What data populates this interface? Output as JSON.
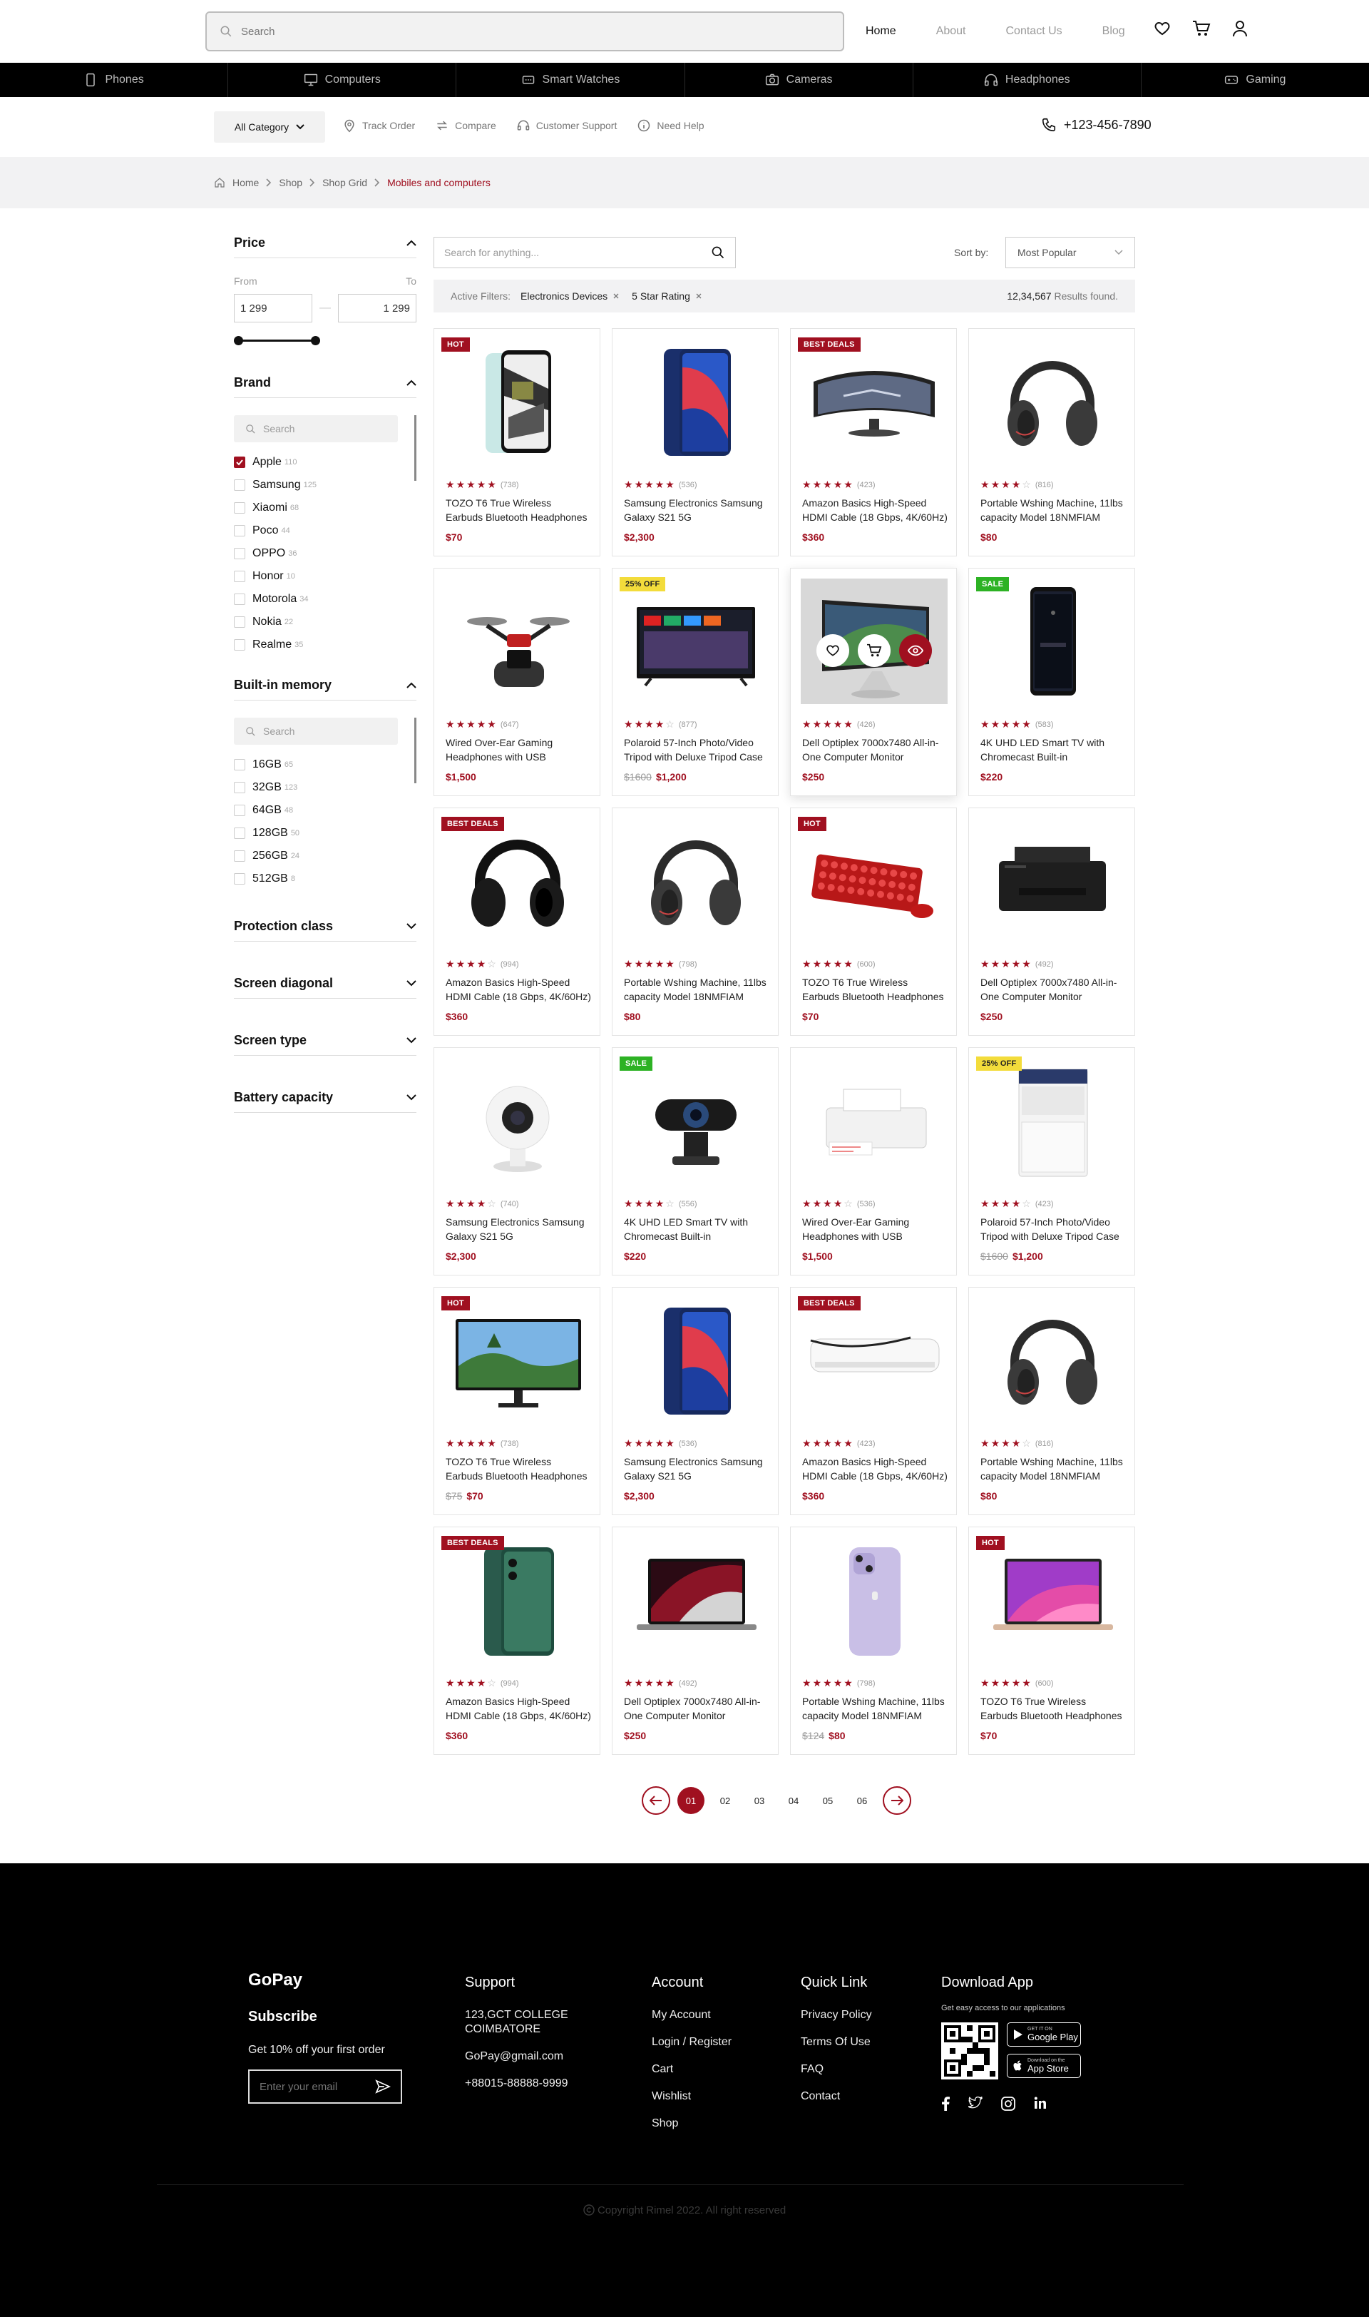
{
  "header": {
    "search_placeholder": "Search",
    "nav": [
      {
        "label": "Home",
        "active": true
      },
      {
        "label": "About",
        "active": false
      },
      {
        "label": "Contact Us",
        "active": false
      },
      {
        "label": "Blog",
        "active": false
      }
    ]
  },
  "categories": [
    {
      "label": "Phones",
      "icon": "phone-icon"
    },
    {
      "label": "Computers",
      "icon": "monitor-icon"
    },
    {
      "label": "Smart Watches",
      "icon": "watch-icon"
    },
    {
      "label": "Cameras",
      "icon": "camera-icon"
    },
    {
      "label": "Headphones",
      "icon": "headphones-icon"
    },
    {
      "label": "Gaming",
      "icon": "gamepad-icon"
    }
  ],
  "subbar": {
    "all_category": "All Category",
    "links": [
      {
        "label": "Track Order",
        "icon": "location-pin-icon"
      },
      {
        "label": "Compare",
        "icon": "compare-arrows-icon"
      },
      {
        "label": "Customer Support",
        "icon": "headset-icon"
      },
      {
        "label": "Need Help",
        "icon": "info-circle-icon"
      }
    ],
    "phone": "+123-456-7890"
  },
  "breadcrumb": [
    "Home",
    "Shop",
    "Shop Grid",
    "Mobiles and computers"
  ],
  "filters": {
    "price": {
      "title": "Price",
      "from_label": "From",
      "to_label": "To",
      "from_value": "1 299",
      "to_value": "1 299",
      "range_fraction": [
        0.0,
        0.44
      ]
    },
    "brand": {
      "title": "Brand",
      "search_placeholder": "Search",
      "items": [
        {
          "label": "Apple",
          "count": "110",
          "checked": true
        },
        {
          "label": "Samsung",
          "count": "125",
          "checked": false
        },
        {
          "label": "Xiaomi",
          "count": "68",
          "checked": false
        },
        {
          "label": "Poco",
          "count": "44",
          "checked": false
        },
        {
          "label": "OPPO",
          "count": "36",
          "checked": false
        },
        {
          "label": "Honor",
          "count": "10",
          "checked": false
        },
        {
          "label": "Motorola",
          "count": "34",
          "checked": false
        },
        {
          "label": "Nokia",
          "count": "22",
          "checked": false
        },
        {
          "label": "Realme",
          "count": "35",
          "checked": false
        }
      ]
    },
    "memory": {
      "title": "Built-in memory",
      "search_placeholder": "Search",
      "items": [
        {
          "label": "16GB",
          "count": "65",
          "checked": false
        },
        {
          "label": "32GB",
          "count": "123",
          "checked": false
        },
        {
          "label": "64GB",
          "count": "48",
          "checked": false
        },
        {
          "label": "128GB",
          "count": "50",
          "checked": false
        },
        {
          "label": "256GB",
          "count": "24",
          "checked": false
        },
        {
          "label": "512GB",
          "count": "8",
          "checked": false
        }
      ]
    },
    "collapsed": [
      "Protection class",
      "Screen diagonal",
      "Screen type",
      "Battery capacity"
    ]
  },
  "toolbar": {
    "search_placeholder": "Search for anything...",
    "sort_label": "Sort by:",
    "sort_value": "Most Popular",
    "active_filters_label": "Active Filters:",
    "active_filters": [
      "Electronics Devices",
      "5 Star Rating"
    ],
    "results_count": "12,34,567",
    "results_suffix": "Results found."
  },
  "products": [
    {
      "badge": "HOT",
      "img": "phone-white",
      "rating": 5,
      "count": "(738)",
      "title": "TOZO T6 True Wireless Earbuds Bluetooth Headphones",
      "old": "",
      "price": "$70"
    },
    {
      "badge": "",
      "img": "phone-blue",
      "rating": 5,
      "count": "(536)",
      "title": "Samsung Electronics Samsung Galaxy S21 5G",
      "old": "",
      "price": "$2,300"
    },
    {
      "badge": "BEST DEALS",
      "img": "monitor-curved",
      "rating": 5,
      "count": "(423)",
      "title": "Amazon Basics High-Speed HDMI Cable (18 Gbps, 4K/60Hz)",
      "old": "",
      "price": "$360"
    },
    {
      "badge": "",
      "img": "headphones-dark",
      "rating": 4,
      "count": "(816)",
      "title": "Portable Wshing Machine, 11lbs capacity Model 18NMFIAM",
      "old": "",
      "price": "$80"
    },
    {
      "badge": "",
      "img": "drone",
      "rating": 5,
      "count": "(647)",
      "title": "Wired Over-Ear Gaming Headphones with USB",
      "old": "",
      "price": "$1,500"
    },
    {
      "badge": "25% OFF",
      "img": "tv",
      "rating": 4,
      "count": "(877)",
      "title": "Polaroid 57-Inch Photo/Video Tripod with Deluxe Tripod Case",
      "old": "$1600",
      "price": "$1,200"
    },
    {
      "badge": "",
      "img": "monitor-imac",
      "rating": 5,
      "count": "(426)",
      "title": "Dell Optiplex 7000x7480 All-in-One Computer Monitor",
      "old": "",
      "price": "$250",
      "hover": true
    },
    {
      "badge": "SALE",
      "img": "phone-black",
      "rating": 5,
      "count": "(583)",
      "title": "4K UHD LED Smart TV with Chromecast Built-in",
      "old": "",
      "price": "$220"
    },
    {
      "badge": "BEST DEALS",
      "img": "headphones-black",
      "rating": 4,
      "count": "(994)",
      "title": "Amazon Basics High-Speed HDMI Cable (18 Gbps, 4K/60Hz)",
      "old": "",
      "price": "$360"
    },
    {
      "badge": "",
      "img": "headphones-dark",
      "rating": 5,
      "count": "(798)",
      "title": "Portable Wshing Machine, 11lbs capacity Model 18NMFIAM",
      "old": "",
      "price": "$80"
    },
    {
      "badge": "HOT",
      "img": "keyboard-red",
      "rating": 5,
      "count": "(600)",
      "title": "TOZO T6 True Wireless Earbuds Bluetooth Headphones",
      "old": "",
      "price": "$70"
    },
    {
      "badge": "",
      "img": "printer",
      "rating": 5,
      "count": "(492)",
      "title": "Dell Optiplex 7000x7480 All-in-One Computer Monitor",
      "old": "",
      "price": "$250"
    },
    {
      "badge": "",
      "img": "security-cam",
      "rating": 4,
      "count": "(740)",
      "title": "Samsung Electronics Samsung Galaxy S21 5G",
      "old": "",
      "price": "$2,300"
    },
    {
      "badge": "SALE",
      "img": "webcam",
      "rating": 4,
      "count": "(556)",
      "title": "4K UHD LED Smart TV with Chromecast Built-in",
      "old": "",
      "price": "$220"
    },
    {
      "badge": "",
      "img": "printer-white",
      "rating": 4,
      "count": "(536)",
      "title": "Wired Over-Ear Gaming Headphones with USB",
      "old": "",
      "price": "$1,500"
    },
    {
      "badge": "25% OFF",
      "img": "washer",
      "rating": 4,
      "count": "(423)",
      "title": "Polaroid 57-Inch Photo/Video Tripod with Deluxe Tripod Case",
      "old": "$1600",
      "price": "$1,200"
    },
    {
      "badge": "HOT",
      "img": "monitor-landscape",
      "rating": 5,
      "count": "(738)",
      "title": "TOZO T6 True Wireless Earbuds Bluetooth Headphones",
      "old": "$75",
      "price": "$70"
    },
    {
      "badge": "",
      "img": "phone-blue",
      "rating": 5,
      "count": "(536)",
      "title": "Samsung Electronics Samsung Galaxy S21 5G",
      "old": "",
      "price": "$2,300"
    },
    {
      "badge": "BEST DEALS",
      "img": "ac-unit",
      "rating": 5,
      "count": "(423)",
      "title": "Amazon Basics High-Speed HDMI Cable (18 Gbps, 4K/60Hz)",
      "old": "",
      "price": "$360"
    },
    {
      "badge": "",
      "img": "headphones-dark",
      "rating": 4,
      "count": "(816)",
      "title": "Portable Wshing Machine, 11lbs capacity Model 18NMFIAM",
      "old": "",
      "price": "$80"
    },
    {
      "badge": "BEST DEALS",
      "img": "phone-green",
      "rating": 4,
      "count": "(994)",
      "title": "Amazon Basics High-Speed HDMI Cable (18 Gbps, 4K/60Hz)",
      "old": "",
      "price": "$360"
    },
    {
      "badge": "",
      "img": "laptop-dark",
      "rating": 5,
      "count": "(492)",
      "title": "Dell Optiplex 7000x7480 All-in-One Computer Monitor",
      "old": "",
      "price": "$250"
    },
    {
      "badge": "",
      "img": "iphone-purple",
      "rating": 5,
      "count": "(798)",
      "title": "Portable Wshing Machine, 11lbs capacity Model 18NMFIAM",
      "old": "$124",
      "price": "$80"
    },
    {
      "badge": "HOT",
      "img": "laptop-pink",
      "rating": 5,
      "count": "(600)",
      "title": "TOZO T6 True Wireless Earbuds Bluetooth Headphones",
      "old": "",
      "price": "$70"
    }
  ],
  "pagination": {
    "pages": [
      "01",
      "02",
      "03",
      "04",
      "05",
      "06"
    ],
    "current": "01"
  },
  "footer": {
    "brand": "GoPay",
    "subscribe_title": "Subscribe",
    "subscribe_text": "Get 10% off your first order",
    "email_placeholder": "Enter your email",
    "support": {
      "title": "Support",
      "lines": [
        "123,GCT COLLEGE COIMBATORE",
        "GoPay@gmail.com",
        "+88015-88888-9999"
      ]
    },
    "account": {
      "title": "Account",
      "links": [
        "My Account",
        "Login / Register",
        "Cart",
        "Wishlist",
        "Shop"
      ]
    },
    "quick": {
      "title": "Quick Link",
      "links": [
        "Privacy Policy",
        "Terms Of Use",
        "FAQ",
        "Contact"
      ]
    },
    "download": {
      "title": "Download App",
      "text": "Get easy access to our applications",
      "google_small": "GET IT ON",
      "google": "Google Play",
      "apple_small": "Download on the",
      "apple": "App Store"
    },
    "copyright": "Copyright Rimel 2022. All right reserved"
  },
  "colors": {
    "accent": "#a01020",
    "sale": "#2db224",
    "off": "#f3dc3b"
  }
}
